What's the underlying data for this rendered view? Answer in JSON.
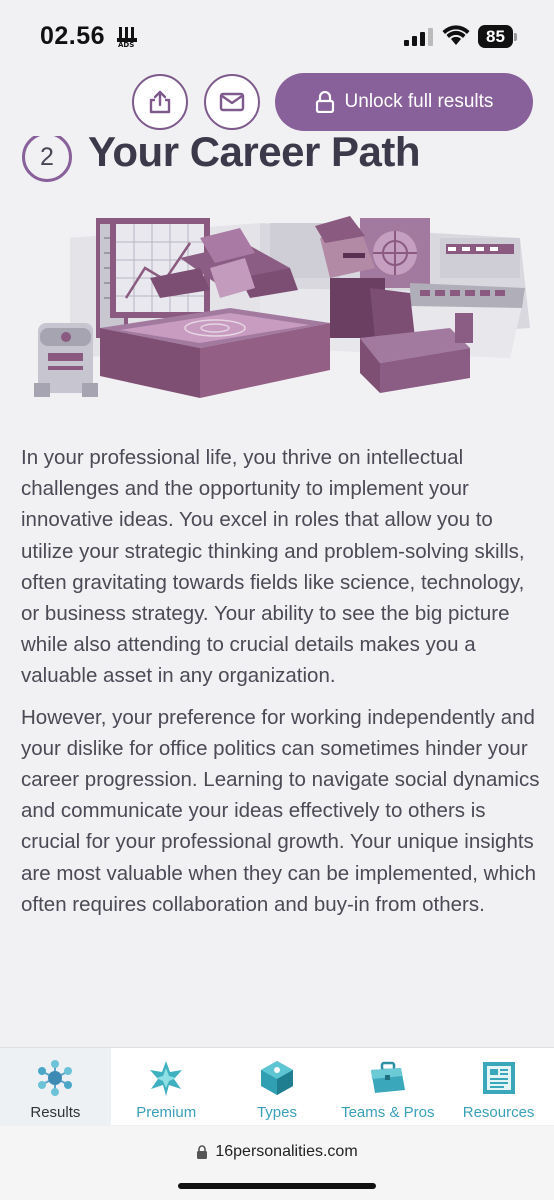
{
  "status_bar": {
    "time": "02.56",
    "battery": "85",
    "icons": [
      "signal-icon",
      "wifi-icon",
      "battery-icon"
    ]
  },
  "action_bar": {
    "share_icon": "share-icon",
    "mail_icon": "mail-icon",
    "unlock_label": "Unlock full results",
    "lock_icon": "lock-icon"
  },
  "section": {
    "number": "2",
    "title": "Your Career Path"
  },
  "content": {
    "paragraphs": [
      "In your professional life, you thrive on intellectual challenges and the opportunity to implement your innovative ideas. You excel in roles that allow you to utilize your strategic thinking and problem-solving skills, often gravitating towards fields like science, technology, or business strategy. Your ability to see the big picture while also attending to crucial details makes you a valuable asset in any organization.",
      "However, your preference for working independently and your dislike for office politics can sometimes hinder your career progression. Learning to navigate social dynamics and communicate your ideas effectively to others is crucial for your professional growth. Your unique insights are most valuable when they can be implemented, which often requires collaboration and buy-in from others."
    ]
  },
  "bottom_nav": {
    "items": [
      {
        "label": "Results",
        "icon": "results-icon",
        "active": true
      },
      {
        "label": "Premium",
        "icon": "premium-icon",
        "active": false
      },
      {
        "label": "Types",
        "icon": "types-icon",
        "active": false
      },
      {
        "label": "Teams & Pros",
        "icon": "briefcase-icon",
        "active": false
      },
      {
        "label": "Resources",
        "icon": "resources-icon",
        "active": false
      }
    ]
  },
  "url_bar": {
    "url": "16personalities.com"
  },
  "colors": {
    "accent": "#88619a",
    "text": "#4b4a55",
    "nav_teal": "#3aa0b8"
  }
}
